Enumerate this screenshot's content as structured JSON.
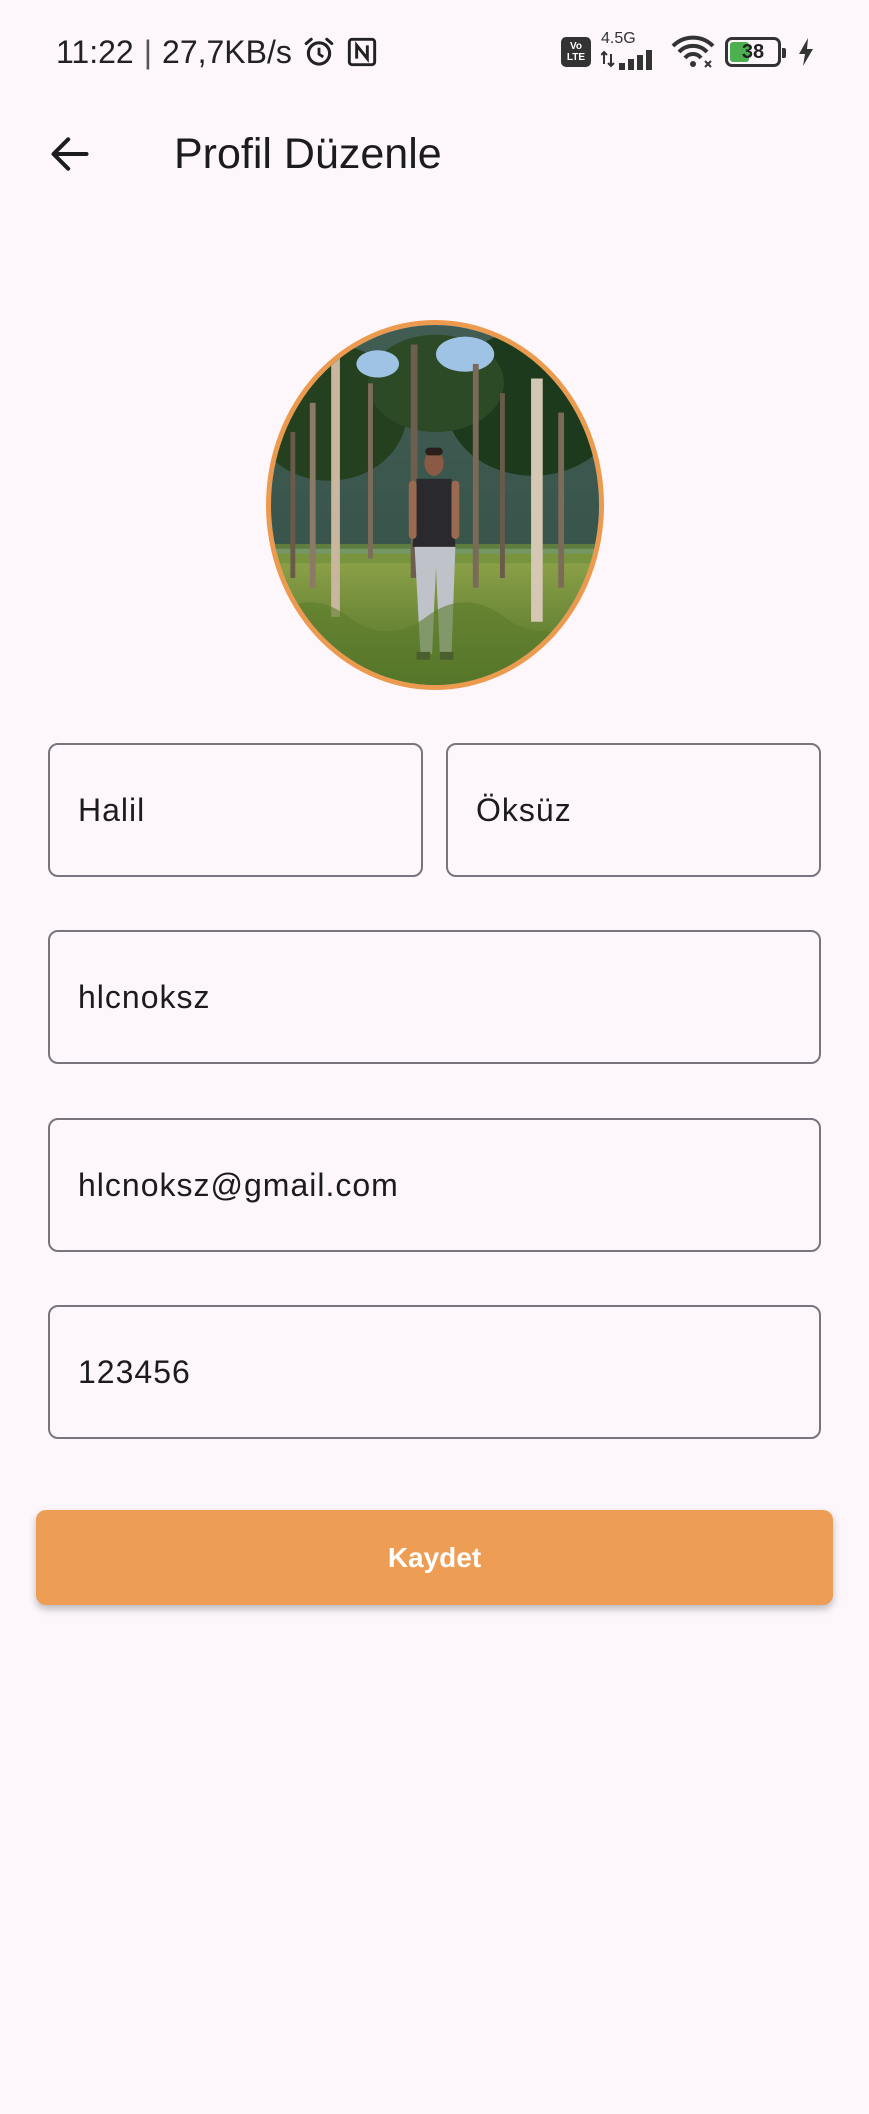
{
  "status_bar": {
    "time": "11:22",
    "separator": "|",
    "net_speed": "27,7KB/s",
    "network_type": "4.5G",
    "volte_top": "Vo",
    "volte_bottom": "LTE",
    "battery_level": "38",
    "battery_fill_fraction": 0.38,
    "icons": [
      "alarm-icon",
      "nfc-icon",
      "volte-icon",
      "signal-icon",
      "wifi-icon",
      "battery-icon",
      "charging-icon"
    ]
  },
  "app_bar": {
    "back_icon": "arrow-left-icon",
    "title": "Profil Düzenle"
  },
  "form": {
    "first_name": "Halil",
    "last_name": "Öksüz",
    "username": "hlcnoksz",
    "email": "hlcnoksz@gmail.com",
    "password": "123456"
  },
  "save_button": {
    "label": "Kaydet"
  },
  "colors": {
    "background": "#fdf7fc",
    "accent": "#ee9d55",
    "avatar_border": "#ec9a4e",
    "field_border": "#79747e"
  }
}
